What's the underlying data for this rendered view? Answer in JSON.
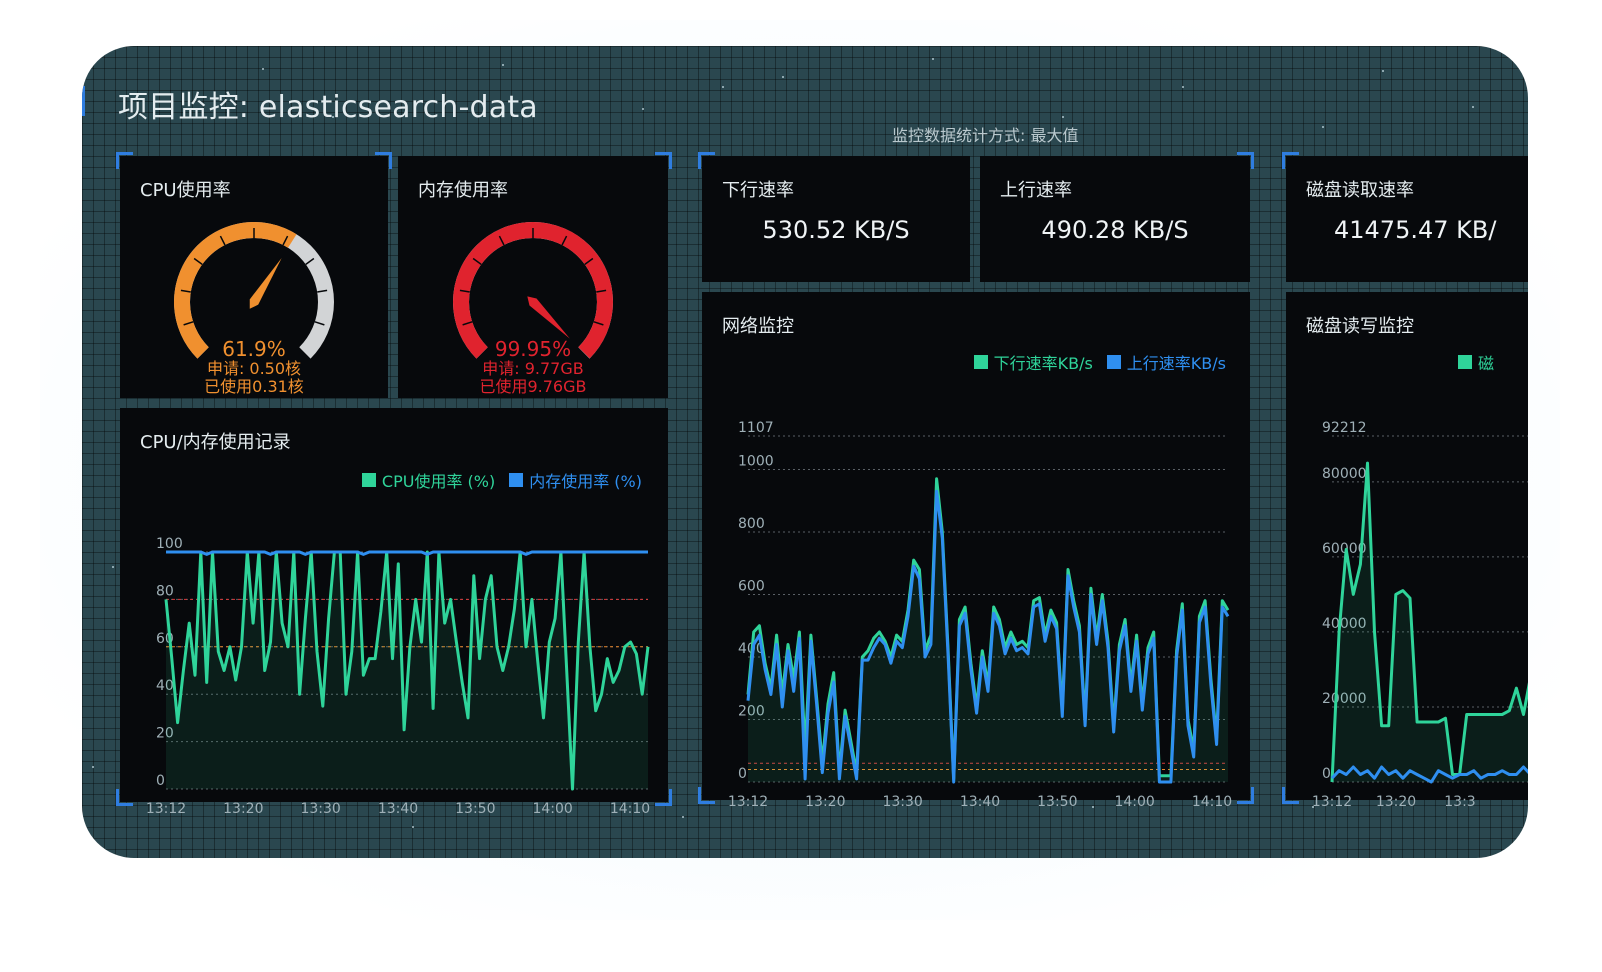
{
  "page": {
    "title": "项目监控: elasticsearch-data",
    "stat_mode": "监控数据统计方式: 最大值"
  },
  "gauges": {
    "cpu": {
      "title": "CPU使用率",
      "percent": 61.9,
      "percent_label": "61.9%",
      "request_label": "申请: 0.50核",
      "used_label": "已使用0.31核",
      "color": "#f0902f"
    },
    "memory": {
      "title": "内存使用率",
      "percent": 99.95,
      "percent_label": "99.95%",
      "request_label": "申请: 9.77GB",
      "used_label": "已使用9.76GB",
      "color": "#e0232e"
    }
  },
  "rates": {
    "down": {
      "title": "下行速率",
      "value": "530.52 KB/S"
    },
    "up": {
      "title": "上行速率",
      "value": "490.28 KB/S"
    },
    "disk_read": {
      "title": "磁盘读取速率",
      "value": "41475.47 KB/"
    }
  },
  "colors": {
    "green": "#2fd49a",
    "blue": "#2f8ff0",
    "accent": "#2f7de0",
    "red_line": "#d83b3b",
    "orange_line": "#e8862a"
  },
  "chart_data": [
    {
      "type": "line",
      "title": "CPU/内存使用记录",
      "x_ticks": [
        "13:12",
        "13:20",
        "13:30",
        "13:40",
        "13:50",
        "14:00",
        "14:10"
      ],
      "y_ticks": [
        "100",
        "80",
        "60",
        "40",
        "20",
        "0"
      ],
      "ylim": [
        0,
        100
      ],
      "threshold_lines": [
        80,
        60
      ],
      "series": [
        {
          "name": "CPU使用率 (%)",
          "color": "#2fd49a",
          "values": [
            80,
            55,
            28,
            50,
            70,
            48,
            100,
            45,
            100,
            58,
            50,
            60,
            46,
            60,
            100,
            70,
            100,
            50,
            62,
            100,
            70,
            60,
            100,
            40,
            72,
            100,
            58,
            35,
            72,
            100,
            100,
            40,
            58,
            100,
            48,
            55,
            55,
            75,
            100,
            55,
            95,
            25,
            60,
            80,
            62,
            100,
            34,
            100,
            70,
            80,
            62,
            45,
            30,
            90,
            55,
            80,
            90,
            60,
            50,
            60,
            76,
            100,
            60,
            80,
            54,
            30,
            62,
            72,
            100,
            50,
            0,
            62,
            100,
            60,
            33,
            40,
            55,
            45,
            50,
            60,
            62,
            57,
            40,
            60
          ]
        },
        {
          "name": "内存使用率 (%)",
          "color": "#2f8ff0",
          "values": [
            100,
            100,
            100,
            100,
            100,
            100,
            100,
            99,
            100,
            100,
            100,
            100,
            100,
            100,
            100,
            100,
            100,
            100,
            99,
            100,
            100,
            100,
            100,
            100,
            99,
            100,
            100,
            100,
            100,
            100,
            100,
            100,
            100,
            100,
            99,
            100,
            100,
            100,
            100,
            100,
            100,
            100,
            100,
            100,
            100,
            99,
            100,
            100,
            100,
            100,
            100,
            100,
            100,
            100,
            100,
            100,
            100,
            100,
            100,
            100,
            100,
            100,
            99,
            100,
            100,
            100,
            100,
            100,
            100,
            100,
            100,
            100,
            100,
            100,
            100,
            100,
            100,
            100,
            100,
            100,
            100,
            100,
            100,
            100
          ]
        }
      ]
    },
    {
      "type": "line",
      "title": "网络监控",
      "x_ticks": [
        "13:12",
        "13:20",
        "13:30",
        "13:40",
        "13:50",
        "14:00",
        "14:10"
      ],
      "y_ticks": [
        "1107",
        "1000",
        "800",
        "600",
        "400",
        "200",
        "0"
      ],
      "ylim": [
        0,
        1107
      ],
      "threshold_lines": [
        60,
        40
      ],
      "series": [
        {
          "name": "下行速率KB/s",
          "color": "#2fd49a",
          "values": [
            280,
            480,
            500,
            380,
            300,
            470,
            280,
            440,
            330,
            480,
            100,
            470,
            270,
            60,
            250,
            350,
            30,
            230,
            130,
            30,
            400,
            420,
            460,
            480,
            450,
            400,
            470,
            450,
            550,
            710,
            680,
            420,
            470,
            970,
            800,
            430,
            10,
            520,
            560,
            380,
            240,
            420,
            310,
            560,
            520,
            430,
            480,
            440,
            450,
            430,
            580,
            590,
            470,
            550,
            510,
            230,
            680,
            580,
            500,
            200,
            620,
            460,
            600,
            450,
            180,
            440,
            520,
            310,
            470,
            250,
            430,
            480,
            20,
            20,
            20,
            420,
            570,
            200,
            100,
            530,
            580,
            330,
            140,
            580,
            550
          ]
        },
        {
          "name": "上行速率KB/s",
          "color": "#2f8ff0",
          "values": [
            260,
            440,
            470,
            360,
            280,
            440,
            240,
            420,
            290,
            460,
            10,
            450,
            250,
            30,
            220,
            320,
            10,
            210,
            110,
            10,
            390,
            390,
            430,
            460,
            440,
            380,
            450,
            430,
            530,
            690,
            650,
            400,
            440,
            930,
            780,
            410,
            0,
            500,
            540,
            360,
            220,
            400,
            290,
            540,
            500,
            410,
            460,
            420,
            430,
            410,
            560,
            570,
            450,
            530,
            490,
            210,
            660,
            560,
            480,
            180,
            600,
            440,
            580,
            430,
            160,
            420,
            500,
            290,
            450,
            230,
            410,
            460,
            0,
            0,
            0,
            400,
            550,
            180,
            80,
            510,
            560,
            310,
            120,
            560,
            530
          ]
        }
      ]
    },
    {
      "type": "line",
      "title": "磁盘读写监控",
      "x_ticks": [
        "13:12",
        "13:20",
        "13:3"
      ],
      "y_ticks": [
        "92212",
        "80000",
        "60000",
        "40000",
        "20000",
        "0"
      ],
      "ylim": [
        0,
        92212
      ],
      "series": [
        {
          "name": "磁",
          "color": "#2fd49a",
          "values": [
            0,
            40000,
            62000,
            50000,
            58000,
            85000,
            40000,
            15000,
            15000,
            50000,
            51000,
            49000,
            16000,
            16000,
            16000,
            16000,
            17000,
            2000,
            2000,
            18000,
            18000,
            18000,
            18000,
            18000,
            18000,
            19000,
            25000,
            18000,
            28000,
            18000,
            19000,
            21000,
            18000,
            17000
          ]
        },
        {
          "name": "",
          "color": "#2f8ff0",
          "values": [
            1000,
            3000,
            2000,
            4000,
            2000,
            3000,
            1000,
            4000,
            2000,
            3000,
            1000,
            3000,
            2000,
            1000,
            0,
            3000,
            2000,
            1000,
            2000,
            2000,
            3000,
            1000,
            2000,
            2000,
            3000,
            2000,
            2000,
            4000,
            2000,
            3000,
            2000,
            3000,
            2000,
            3000
          ]
        }
      ]
    }
  ]
}
